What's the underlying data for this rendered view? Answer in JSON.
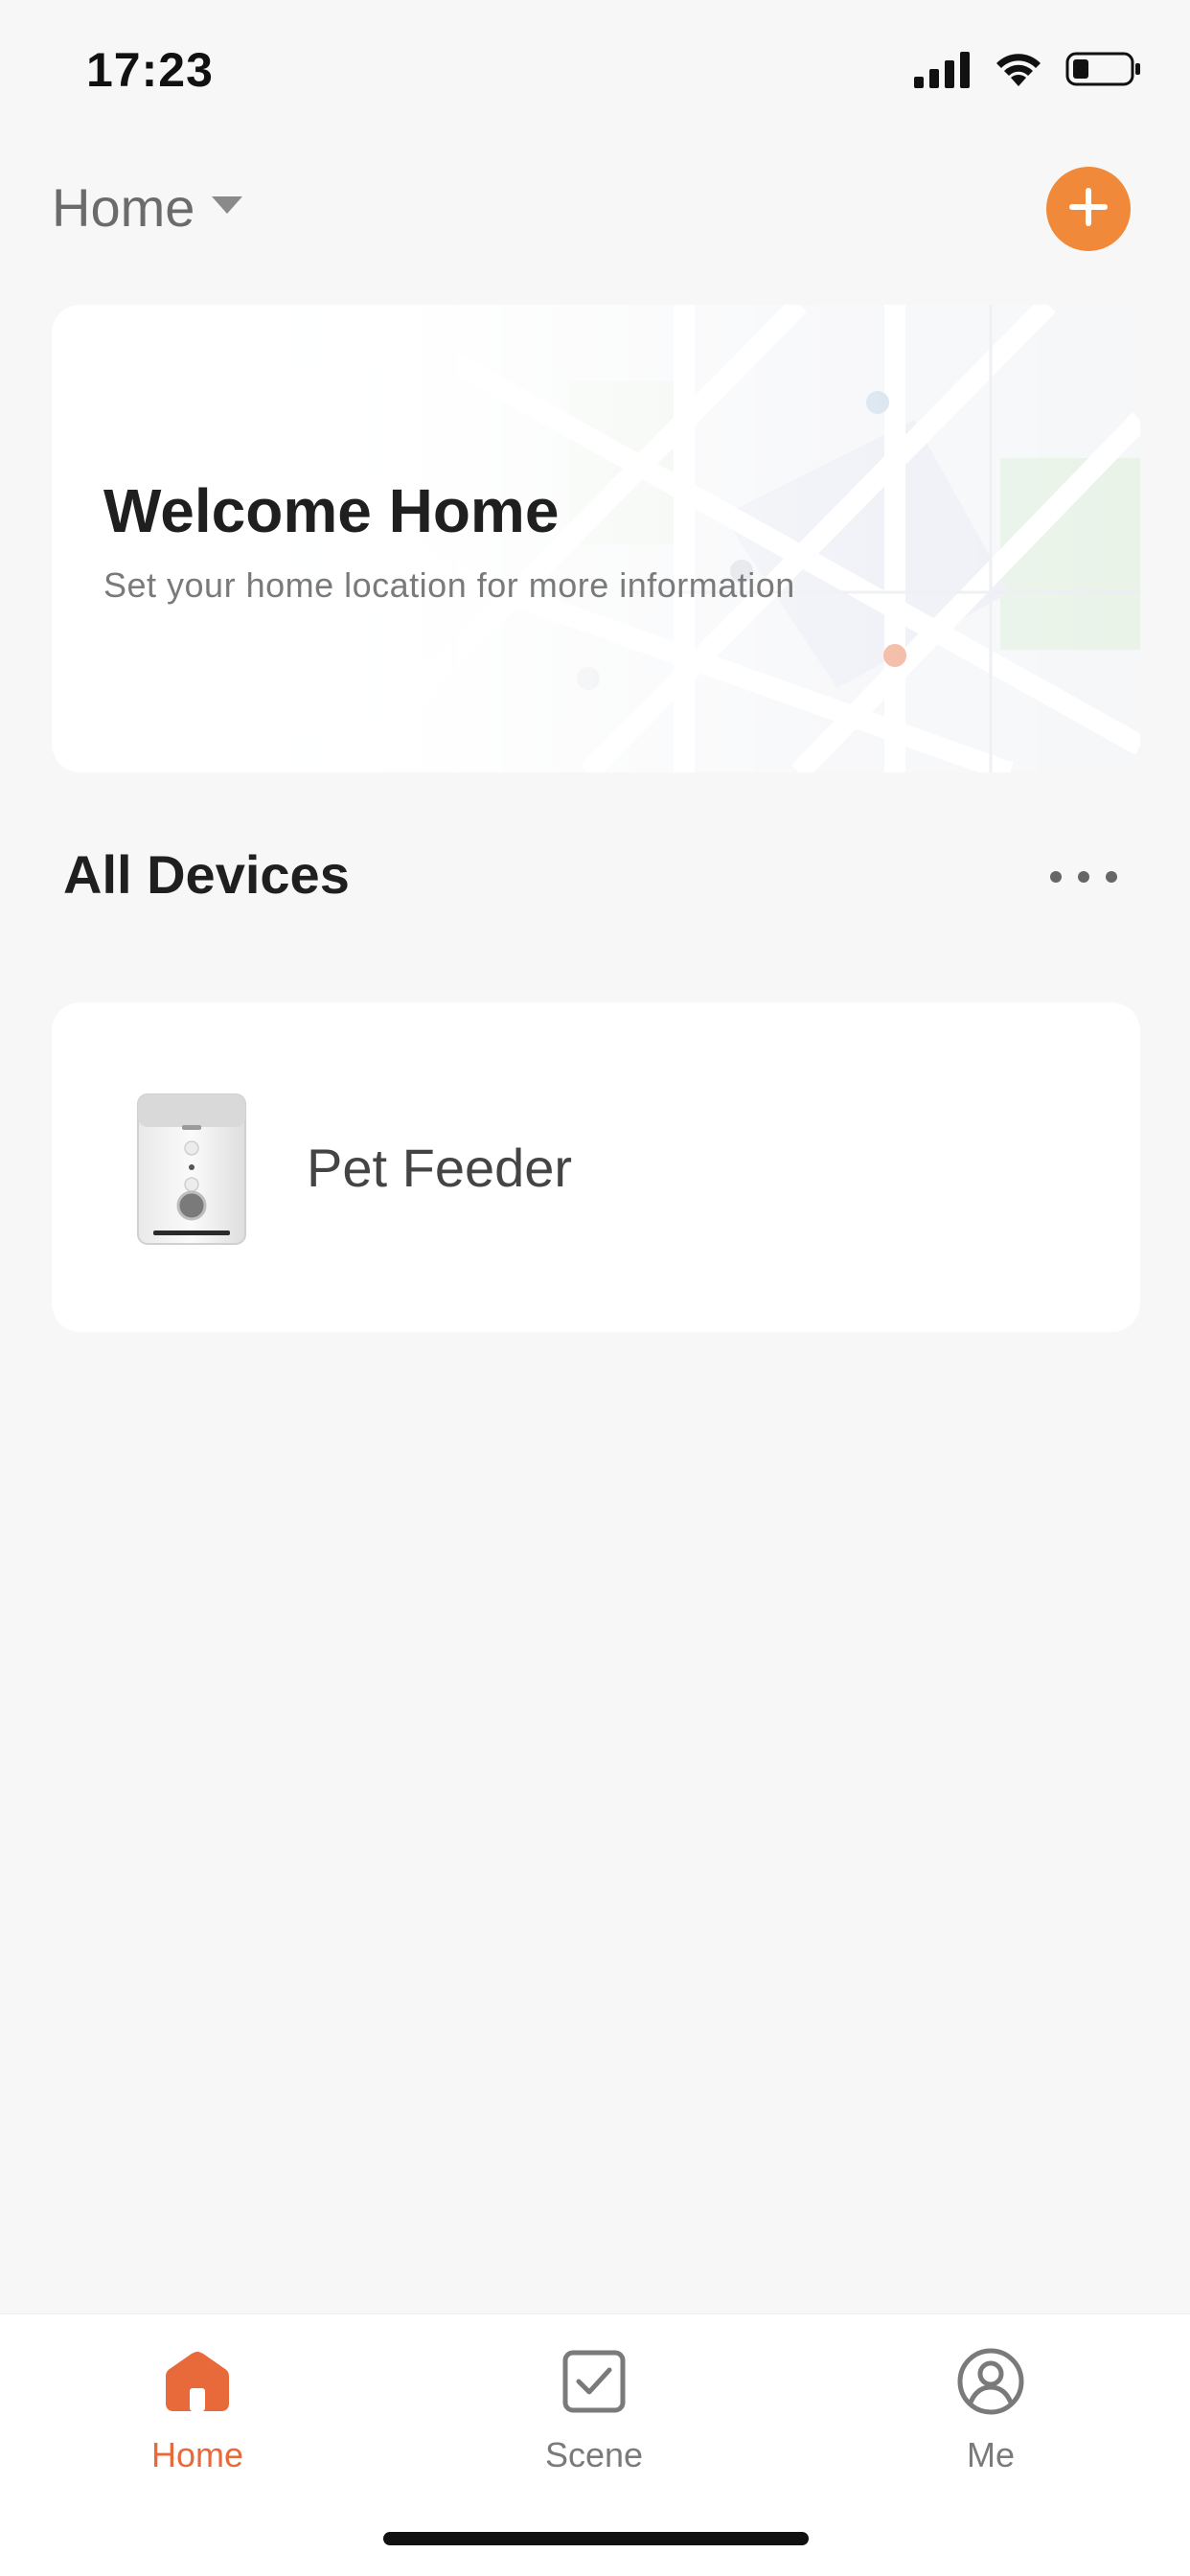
{
  "status_bar": {
    "time": "17:23"
  },
  "header": {
    "home_label": "Home"
  },
  "welcome_card": {
    "title": "Welcome Home",
    "subtitle": "Set your home location for more information"
  },
  "devices": {
    "section_title": "All Devices",
    "items": [
      {
        "name": "Pet Feeder",
        "icon": "pet-feeder-image"
      }
    ]
  },
  "tab_bar": {
    "tabs": [
      {
        "label": "Home",
        "icon": "home-icon",
        "active": true
      },
      {
        "label": "Scene",
        "icon": "scene-icon",
        "active": false
      },
      {
        "label": "Me",
        "icon": "profile-icon",
        "active": false
      }
    ]
  },
  "colors": {
    "accent_orange": "#f08a3a",
    "active_tab": "#e8693a",
    "background": "#f7f7f7",
    "card": "#ffffff"
  }
}
